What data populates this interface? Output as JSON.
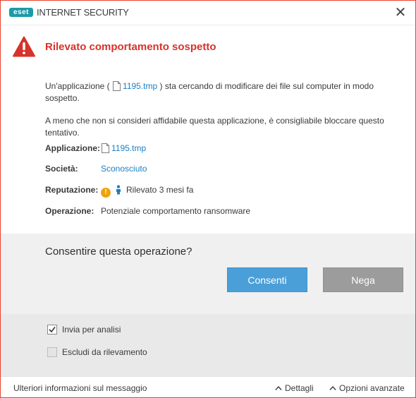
{
  "window": {
    "logo_text": "eset",
    "product_name": "INTERNET SECURITY",
    "close_symbol": "✕"
  },
  "alert": {
    "title": "Rilevato comportamento sospetto",
    "icon": "warning-triangle-icon",
    "accent_color": "#d6332b"
  },
  "description": {
    "line1_prefix": "Un'applicazione (",
    "line1_file": "1195.tmp",
    "line1_suffix": ") sta cercando di modificare dei file sul computer in modo sospetto.",
    "line2": "A meno che non si consideri affidabile questa applicazione, è consigliabile bloccare questo tentativo."
  },
  "details": {
    "application_label": "Applicazione:",
    "application_value": "1195.tmp",
    "company_label": "Società:",
    "company_value": "Sconosciuto",
    "reputation_label": "Reputazione:",
    "reputation_value": "Rilevato 3 mesi fa",
    "operation_label": "Operazione:",
    "operation_value": "Potenziale comportamento ransomware"
  },
  "prompt": {
    "question": "Consentire questa operazione?",
    "allow_label": "Consenti",
    "deny_label": "Nega"
  },
  "options": {
    "submit_label": "Invia per analisi",
    "submit_checked": true,
    "exclude_label": "Escludi da rilevamento",
    "exclude_checked": false
  },
  "footer": {
    "more_info": "Ulteriori informazioni sul messaggio",
    "details": "Dettagli",
    "advanced": "Opzioni avanzate"
  }
}
